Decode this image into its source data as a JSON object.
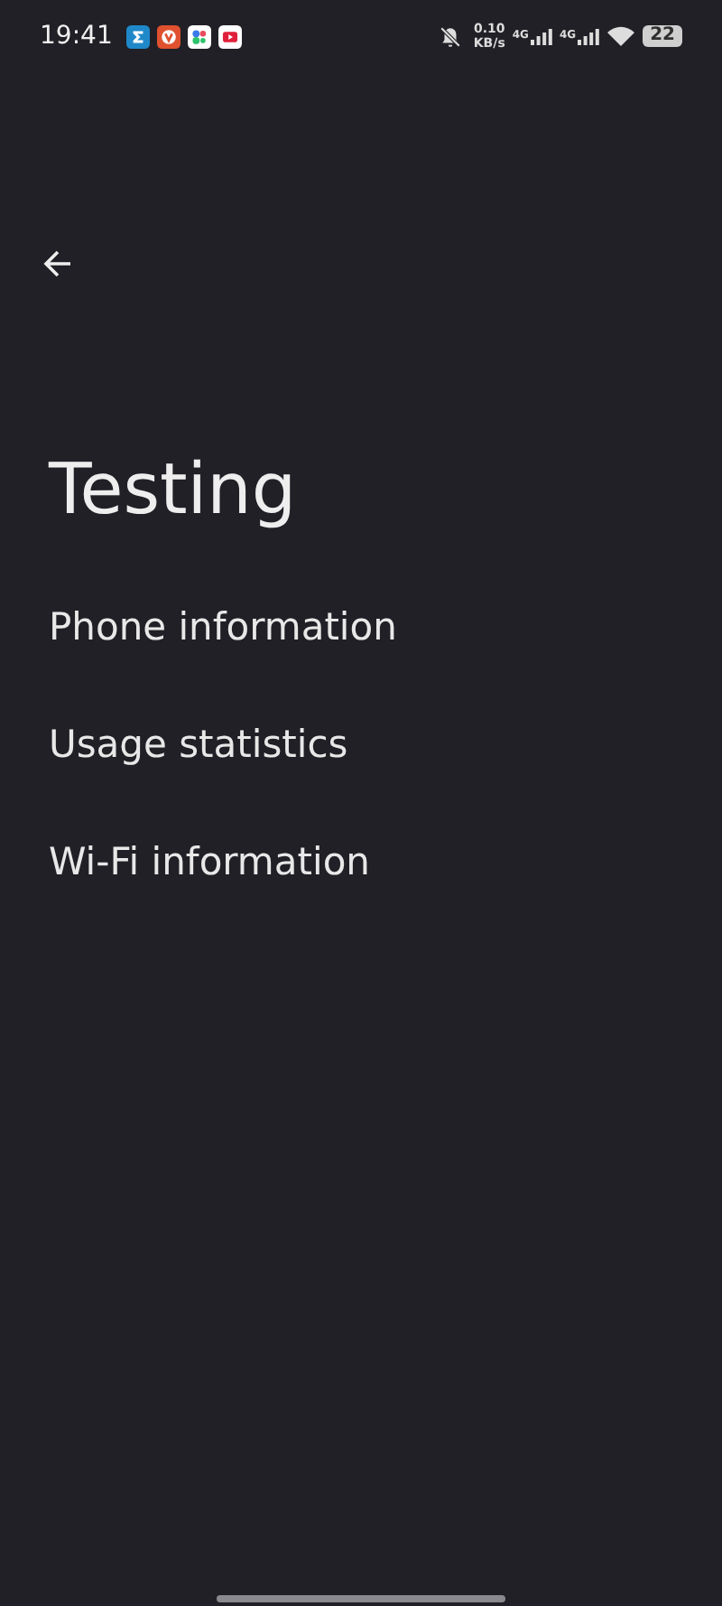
{
  "status_bar": {
    "time": "19:41",
    "speed_value": "0.10",
    "speed_unit": "KB/s",
    "networks": [
      "4G",
      "4G"
    ],
    "battery": "22"
  },
  "title": "Testing",
  "items": [
    {
      "label": "Phone information"
    },
    {
      "label": "Usage statistics"
    },
    {
      "label": "Wi-Fi information"
    }
  ]
}
